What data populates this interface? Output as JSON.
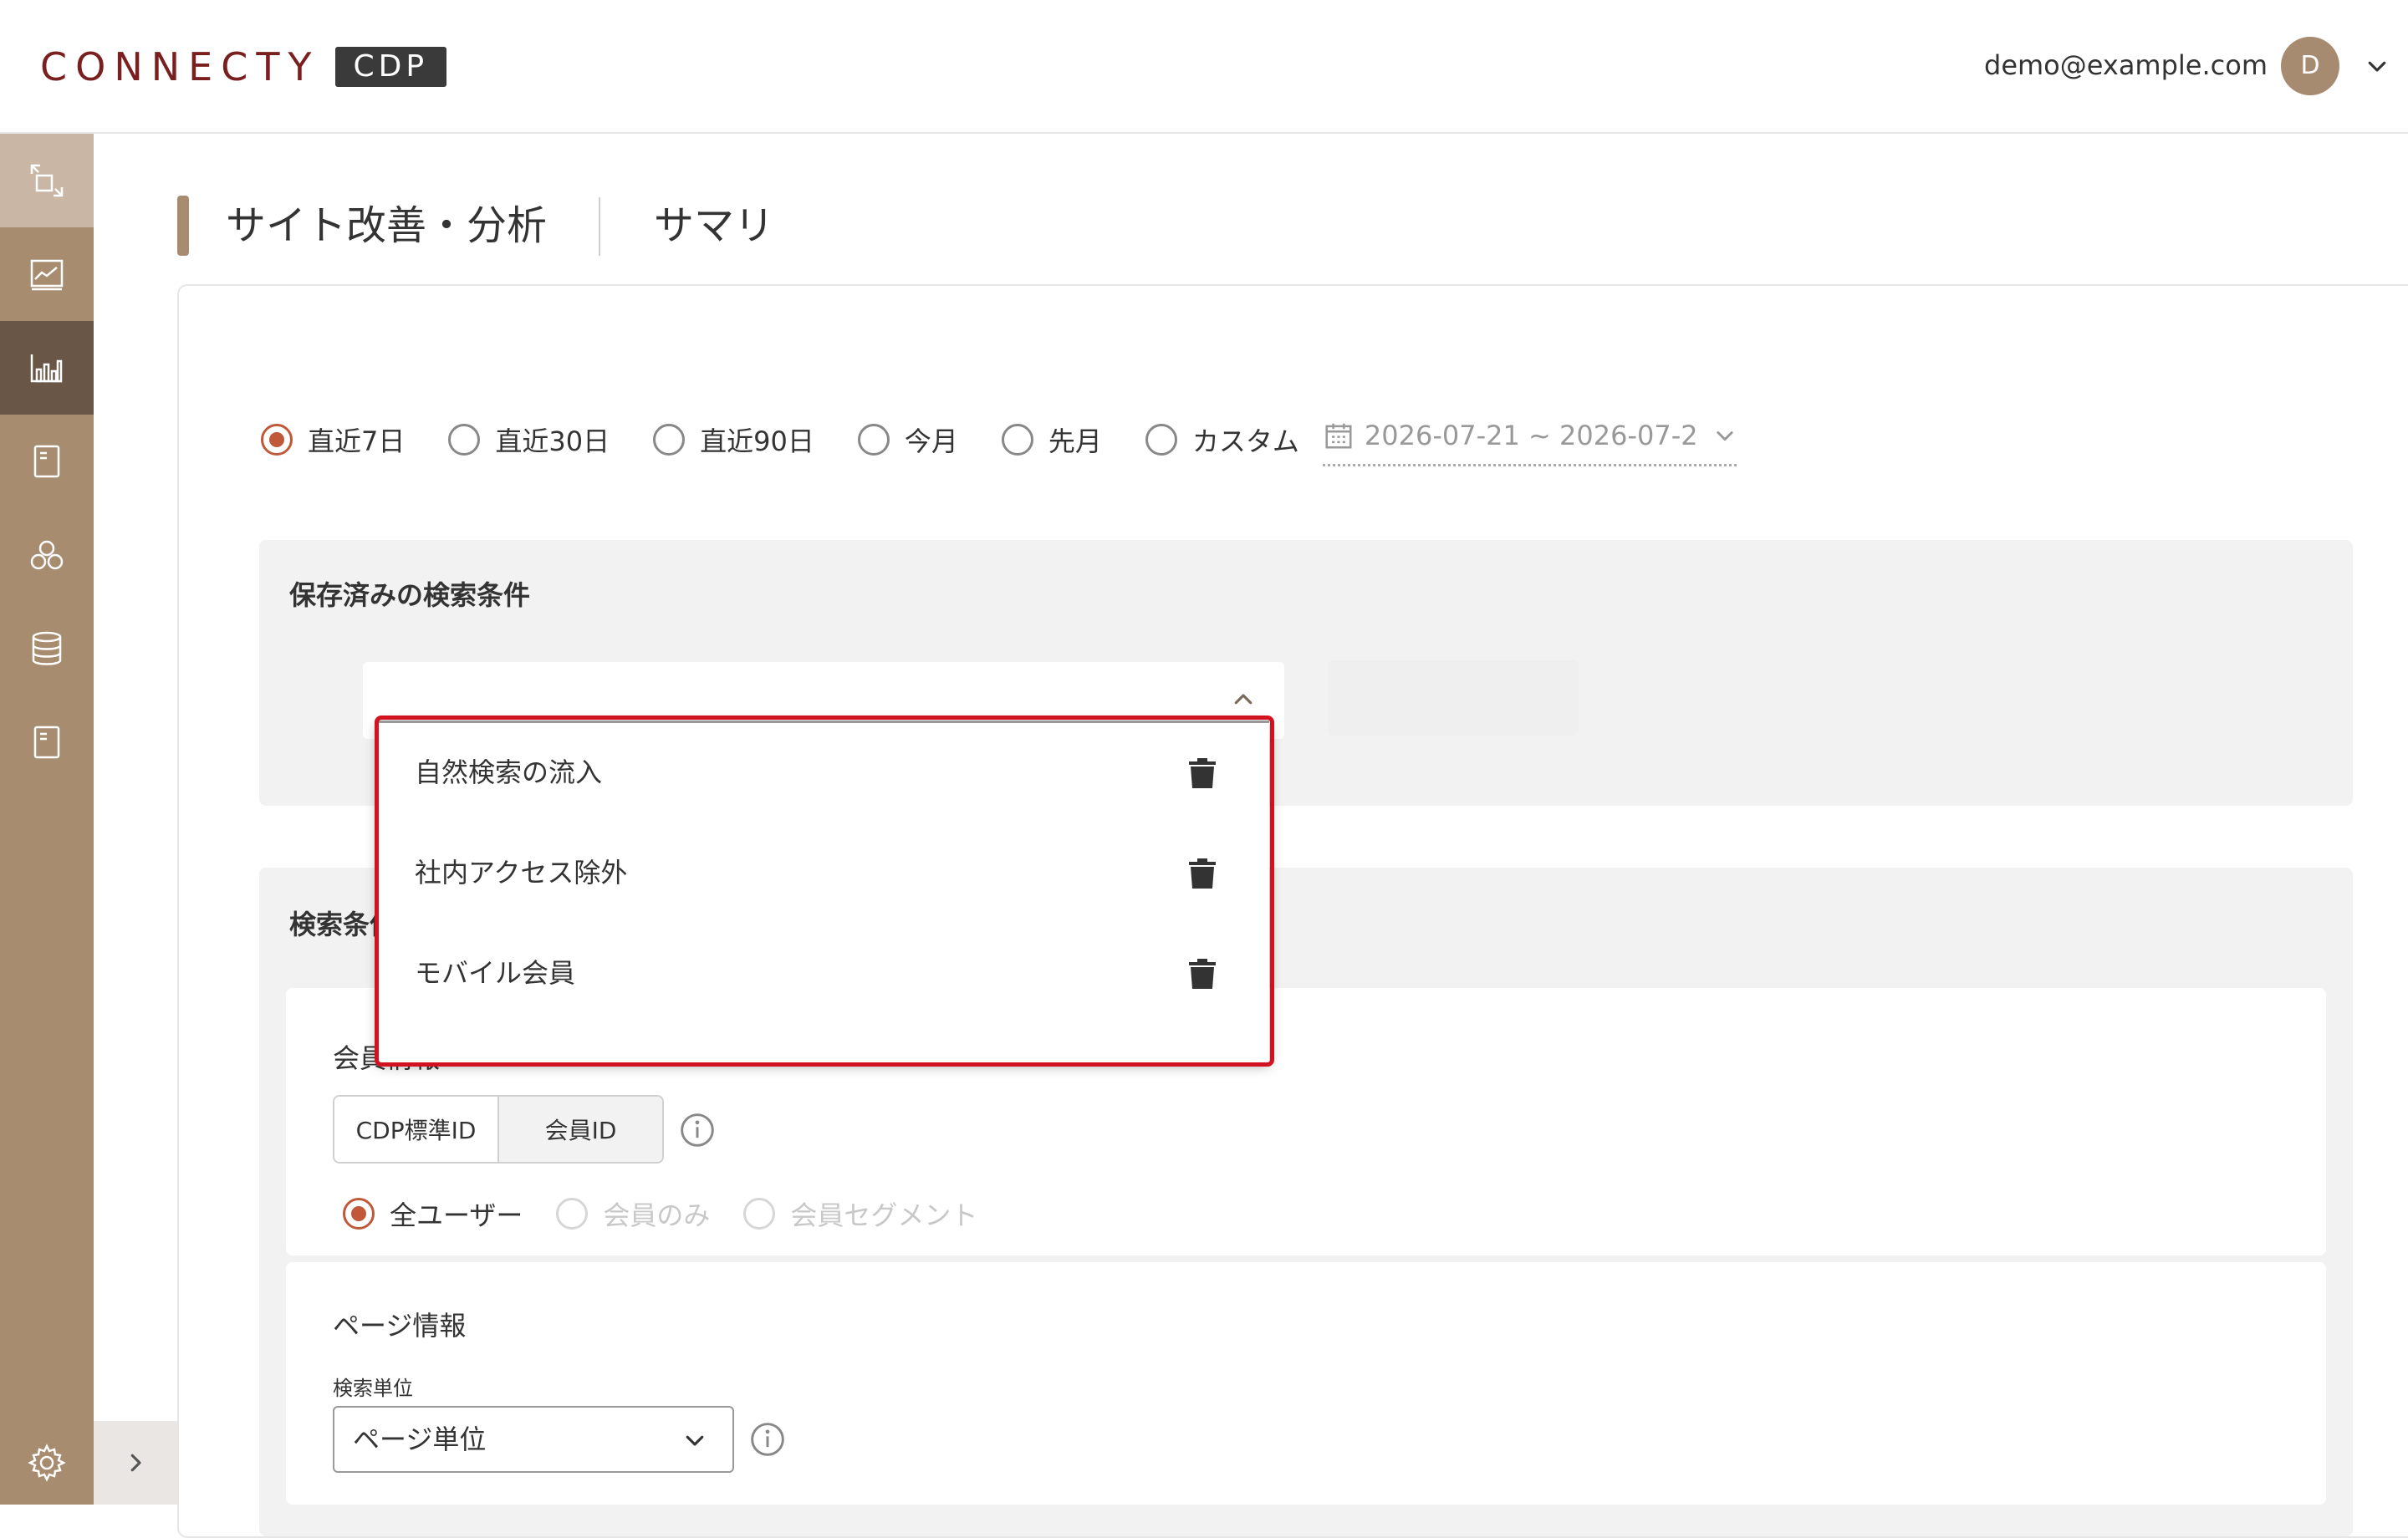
{
  "header": {
    "logo_text": "CONNECTY",
    "logo_badge": "CDP",
    "user_email": "demo@example.com",
    "avatar_initial": "D"
  },
  "sidebar": {
    "items": [
      {
        "icon": "transfer-icon"
      },
      {
        "icon": "monitor-chart-icon"
      },
      {
        "icon": "bar-chart-icon",
        "active": true
      },
      {
        "icon": "document-icon"
      },
      {
        "icon": "segment-circles-icon"
      },
      {
        "icon": "database-icon"
      },
      {
        "icon": "report-icon"
      }
    ],
    "settings_icon": "gear-icon",
    "collapse_icon": "chevron-right-icon"
  },
  "page": {
    "title": "サイト改善・分析",
    "subtitle": "サマリ"
  },
  "period": {
    "options": [
      {
        "label": "直近7日",
        "checked": true
      },
      {
        "label": "直近30日",
        "checked": false
      },
      {
        "label": "直近90日",
        "checked": false
      },
      {
        "label": "今月",
        "checked": false
      },
      {
        "label": "先月",
        "checked": false
      },
      {
        "label": "カスタム",
        "checked": false
      }
    ],
    "date_range": "2026-07-21 ~ 2026-07-2"
  },
  "saved": {
    "title": "保存済みの検索条件",
    "selected_value": "",
    "options": [
      {
        "label": "自然検索の流入"
      },
      {
        "label": "社内アクセス除外"
      },
      {
        "label": "モバイル会員"
      }
    ]
  },
  "conditions": {
    "title": "検索条件",
    "member": {
      "label": "会員情報",
      "id_toggle": [
        "CDP標準ID",
        "会員ID"
      ],
      "user_options": [
        {
          "label": "全ユーザー",
          "checked": true,
          "disabled": false
        },
        {
          "label": "会員のみ",
          "checked": false,
          "disabled": true
        },
        {
          "label": "会員セグメント",
          "checked": false,
          "disabled": true
        }
      ]
    },
    "page_info": {
      "label": "ページ情報",
      "unit_caption": "検索単位",
      "unit_value": "ページ単位"
    }
  },
  "colors": {
    "sidebar": "#a88c70",
    "sidebar_active": "#6a5646",
    "radio_accent": "#c0593a",
    "highlight": "#d3121f",
    "logo": "#7a1f1f"
  }
}
